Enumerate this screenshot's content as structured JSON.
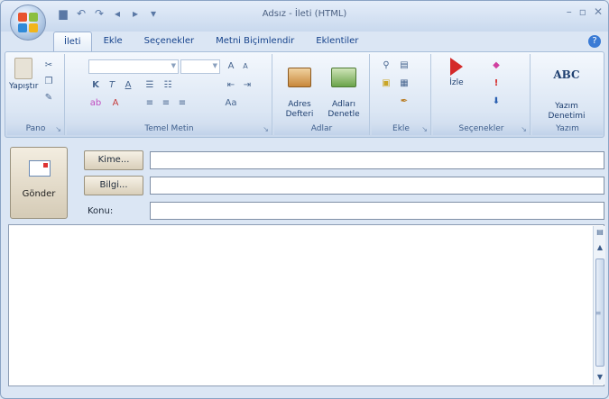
{
  "window": {
    "title": "Adsız - İleti (HTML)"
  },
  "quick_access": {
    "icons": [
      "save-icon",
      "undo-icon",
      "redo-icon",
      "up-arrow-icon",
      "down-arrow-icon",
      "customize-icon"
    ]
  },
  "tabs": [
    {
      "label": "İleti",
      "active": true
    },
    {
      "label": "Ekle",
      "active": false
    },
    {
      "label": "Seçenekler",
      "active": false
    },
    {
      "label": "Metni Biçimlendir",
      "active": false
    },
    {
      "label": "Eklentiler",
      "active": false
    }
  ],
  "ribbon": {
    "pano": {
      "label": "Pano",
      "paste_label": "Yapıştır"
    },
    "temel_metin": {
      "label": "Temel Metin",
      "bold": "K",
      "italic": "T",
      "underline": "A",
      "grow_font": "A",
      "shrink_font": "A"
    },
    "adlar": {
      "label": "Adlar",
      "address_book": "Adres\nDefteri",
      "check_names": "Adları\nDenetle"
    },
    "ekle": {
      "label": "Ekle"
    },
    "secenekler": {
      "label": "Seçenekler",
      "follow_up": "İzle"
    },
    "yazim": {
      "label": "Yazım",
      "spelling": "Yazım\nDenetimi",
      "abc": "ABC"
    }
  },
  "compose": {
    "send_label": "Gönder",
    "to_label": "Kime...",
    "cc_label": "Bilgi...",
    "subject_label": "Konu:",
    "to_value": "",
    "cc_value": "",
    "subject_value": ""
  },
  "colors": {
    "accent": "#15428b",
    "ribbon_bg": "#dbe6f4"
  }
}
